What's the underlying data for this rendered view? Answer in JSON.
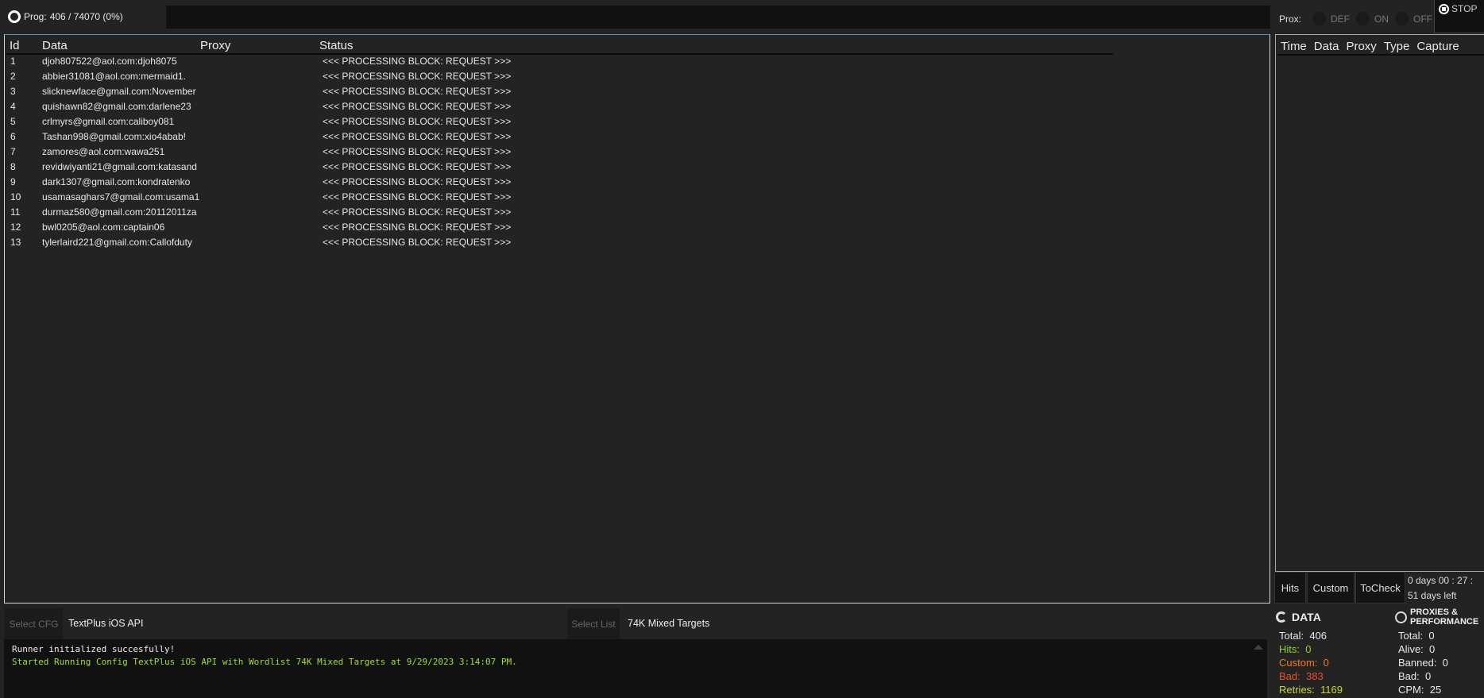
{
  "top": {
    "progress_label": "Prog:",
    "progress_text": "406  /  74070  (0%)",
    "prox_label": "Prox:",
    "prox_options": [
      "DEF",
      "ON",
      "OFF"
    ],
    "stop_label": "STOP"
  },
  "grid": {
    "columns": [
      "Id",
      "Data",
      "Proxy",
      "Status"
    ],
    "rows": [
      {
        "id": "1",
        "data": "djoh807522@aol.com:djoh8075",
        "proxy": "",
        "status": "<<< PROCESSING BLOCK: REQUEST >>>"
      },
      {
        "id": "2",
        "data": "abbier31081@aol.com:mermaid1.",
        "proxy": "",
        "status": "<<< PROCESSING BLOCK: REQUEST >>>"
      },
      {
        "id": "3",
        "data": "slicknewface@gmail.com:November",
        "proxy": "",
        "status": "<<< PROCESSING BLOCK: REQUEST >>>"
      },
      {
        "id": "4",
        "data": "quishawn82@gmail.com:darlene23",
        "proxy": "",
        "status": "<<< PROCESSING BLOCK: REQUEST >>>"
      },
      {
        "id": "5",
        "data": "crlmyrs@gmail.com:caliboy081",
        "proxy": "",
        "status": "<<< PROCESSING BLOCK: REQUEST >>>"
      },
      {
        "id": "6",
        "data": "Tashan998@gmail.com:xio4abab!",
        "proxy": "",
        "status": "<<< PROCESSING BLOCK: REQUEST >>>"
      },
      {
        "id": "7",
        "data": "zamores@aol.com:wawa251",
        "proxy": "",
        "status": "<<< PROCESSING BLOCK: REQUEST >>>"
      },
      {
        "id": "8",
        "data": "revidwiyanti21@gmail.com:katasand",
        "proxy": "",
        "status": "<<< PROCESSING BLOCK: REQUEST >>>"
      },
      {
        "id": "9",
        "data": "dark1307@gmail.com:kondratenko",
        "proxy": "",
        "status": "<<< PROCESSING BLOCK: REQUEST >>>"
      },
      {
        "id": "10",
        "data": "usamasaghars7@gmail.com:usama1",
        "proxy": "",
        "status": "<<< PROCESSING BLOCK: REQUEST >>>"
      },
      {
        "id": "11",
        "data": "durmaz580@gmail.com:20112011za",
        "proxy": "",
        "status": "<<< PROCESSING BLOCK: REQUEST >>>"
      },
      {
        "id": "12",
        "data": "bwl0205@aol.com:captain06",
        "proxy": "",
        "status": "<<< PROCESSING BLOCK: REQUEST >>>"
      },
      {
        "id": "13",
        "data": "tylerlaird221@gmail.com:Callofduty",
        "proxy": "",
        "status": "<<< PROCESSING BLOCK: REQUEST >>>"
      }
    ]
  },
  "captures": {
    "columns": [
      "Time",
      "Data",
      "Proxy",
      "Type",
      "Capture"
    ],
    "tabs": [
      "Hits",
      "Custom",
      "ToCheck"
    ],
    "timer": "0  days  00 : 27 :",
    "days_left": "51 days left"
  },
  "selectors": {
    "cfg_button": "Select CFG",
    "cfg_value": "TextPlus iOS API",
    "list_button": "Select List",
    "list_value": "74K Mixed Targets"
  },
  "log": [
    "Runner initialized succesfully!",
    "Started Running Config TextPlus iOS API with Wordlist 74K Mixed Targets at 9/29/2023 3:14:07 PM."
  ],
  "stats": {
    "data_title": "DATA",
    "data": [
      {
        "label": "Total:",
        "value": "406",
        "color": "#e8e8e8"
      },
      {
        "label": "Hits:",
        "value": "0",
        "color": "#8fd62a"
      },
      {
        "label": "Custom:",
        "value": "0",
        "color": "#f07a1a"
      },
      {
        "label": "Bad:",
        "value": "383",
        "color": "#f0502a"
      },
      {
        "label": "Retries:",
        "value": "1169",
        "color": "#c8d82a"
      }
    ],
    "proxies_title": "PROXIES & PERFORMANCE",
    "proxies": [
      {
        "label": "Total:",
        "value": "0"
      },
      {
        "label": "Alive:",
        "value": "0"
      },
      {
        "label": "Banned:",
        "value": "0"
      },
      {
        "label": "Bad:",
        "value": "0"
      },
      {
        "label": "CPM:",
        "value": "25"
      }
    ]
  }
}
